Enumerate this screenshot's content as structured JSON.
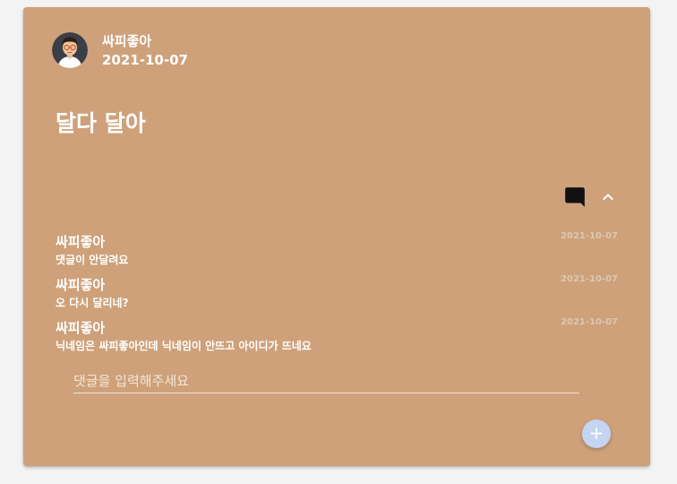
{
  "post": {
    "author": "싸피좋아",
    "date": "2021-10-07",
    "title": "달다 달아"
  },
  "icons": {
    "comment": "comment-icon",
    "collapse": "chevron-up-icon",
    "add": "plus-icon",
    "avatar": "avatar-icon"
  },
  "comments": [
    {
      "author": "싸피좋아",
      "date": "2021-10-07",
      "text": "댓글이 안달려요"
    },
    {
      "author": "싸피좋아",
      "date": "2021-10-07",
      "text": "오 다시 달리네?"
    },
    {
      "author": "싸피좋아",
      "date": "2021-10-07",
      "text": "닉네임은 싸피좋아인데 닉네임이 안뜨고 아이디가 뜨네요"
    }
  ],
  "comment_input": {
    "placeholder": "댓글을 입력해주세요",
    "value": ""
  },
  "fab": {
    "label": "+"
  },
  "colors": {
    "card_background": "#cea17a",
    "page_background": "#f3f3f3",
    "fab_background": "#c4d4f2",
    "text": "#ffffff"
  }
}
